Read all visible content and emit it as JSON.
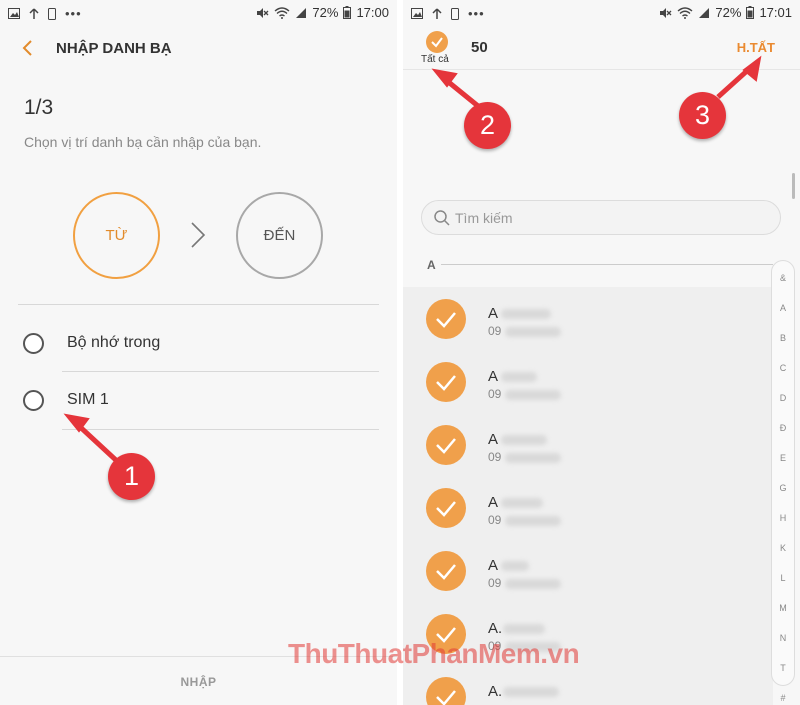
{
  "left_screen": {
    "status": {
      "battery": "72%",
      "time": "17:00"
    },
    "app_title": "NHẬP DANH BẠ",
    "step": "1/3",
    "hint": "Chọn vị trí danh bạ cần nhập của bạn.",
    "from_label": "TỪ",
    "to_label": "ĐẾN",
    "options": [
      "Bộ nhớ trong",
      "SIM 1"
    ],
    "bottom_button": "NHẬP"
  },
  "right_screen": {
    "status": {
      "battery": "72%",
      "time": "17:01"
    },
    "select_all_label": "Tất cả",
    "selected_count": "50",
    "done_button": "H.TẤT",
    "search_placeholder": "Tìm kiếm",
    "section_letter": "A",
    "contacts": [
      {
        "name": "A",
        "phone": "09"
      },
      {
        "name": "A",
        "phone": "09"
      },
      {
        "name": "A",
        "phone": "09"
      },
      {
        "name": "A",
        "phone": "09"
      },
      {
        "name": "A",
        "phone": "09"
      },
      {
        "name": "A.",
        "phone": "09"
      },
      {
        "name": "A.",
        "phone": "09"
      }
    ],
    "index_letters": [
      "&",
      "A",
      "B",
      "C",
      "D",
      "Đ",
      "E",
      "G",
      "H",
      "K",
      "L",
      "M",
      "N",
      "T",
      "#"
    ]
  },
  "annotations": [
    "1",
    "2",
    "3"
  ],
  "watermark": "ThuThuatPhanMem.vn",
  "colors": {
    "accent": "#f0a04b",
    "annotation": "#e5353b"
  }
}
